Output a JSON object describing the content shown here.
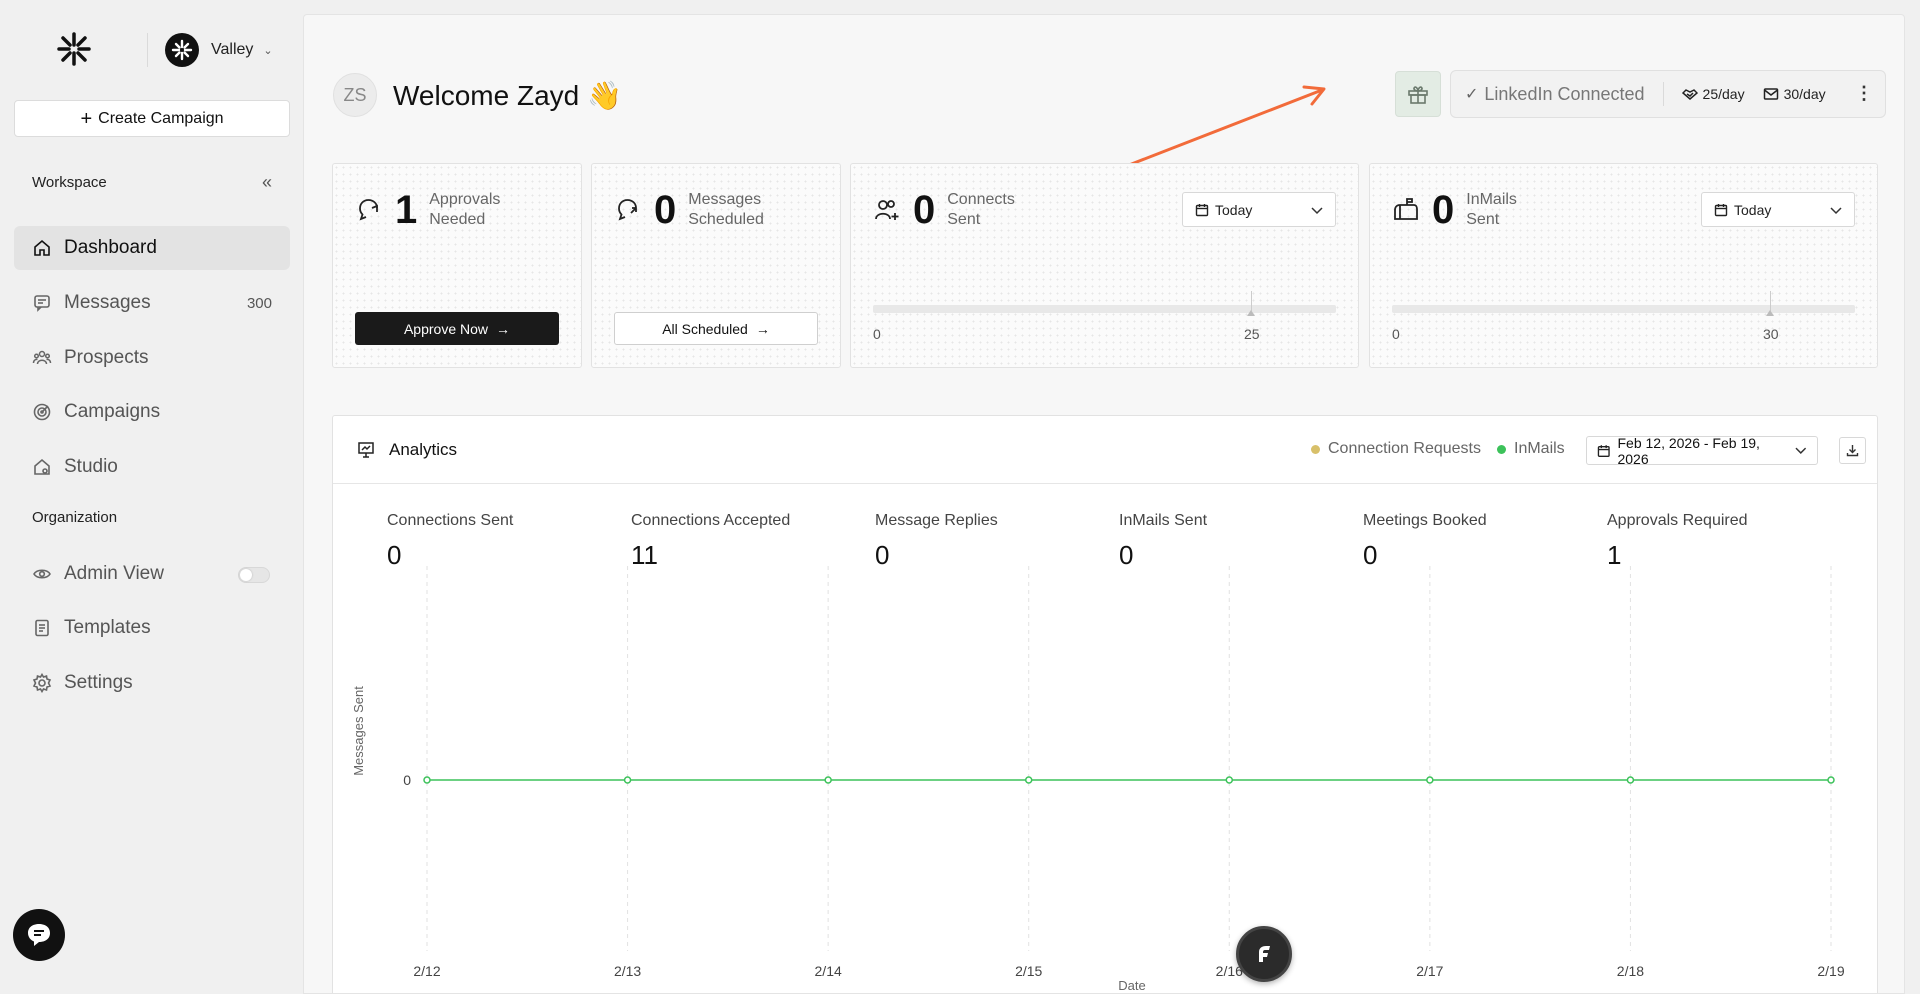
{
  "workspace": {
    "name": "Valley"
  },
  "sidebar": {
    "create_label": "Create Campaign",
    "workspace_label": "Workspace",
    "organization_label": "Organization",
    "items": [
      {
        "label": "Dashboard",
        "icon": "home-icon",
        "active": true
      },
      {
        "label": "Messages",
        "icon": "message-icon",
        "count": "300"
      },
      {
        "label": "Prospects",
        "icon": "users-icon"
      },
      {
        "label": "Campaigns",
        "icon": "target-icon"
      },
      {
        "label": "Studio",
        "icon": "studio-icon"
      }
    ],
    "org_items": [
      {
        "label": "Admin View",
        "icon": "eye-icon",
        "toggle": false
      },
      {
        "label": "Templates",
        "icon": "document-icon"
      },
      {
        "label": "Settings",
        "icon": "gear-icon"
      }
    ]
  },
  "header": {
    "initials": "ZS",
    "welcome": "Welcome Zayd 👋",
    "linkedin_status": "LinkedIn Connected",
    "connect_limit": "25/day",
    "inmail_limit": "30/day"
  },
  "cards": {
    "approvals": {
      "value": "1",
      "label_1": "Approvals",
      "label_2": "Needed",
      "button": "Approve Now"
    },
    "scheduled": {
      "value": "0",
      "label_1": "Messages",
      "label_2": "Scheduled",
      "button": "All Scheduled"
    },
    "connects": {
      "value": "0",
      "label_1": "Connects",
      "label_2": "Sent",
      "range": "Today",
      "min": "0",
      "max": "25",
      "progress": 0
    },
    "inmails": {
      "value": "0",
      "label_1": "InMails",
      "label_2": "Sent",
      "range": "Today",
      "min": "0",
      "max": "30",
      "progress": 0
    }
  },
  "analytics": {
    "title": "Analytics",
    "legend": [
      {
        "label": "Connection Requests",
        "color": "#d8c06a"
      },
      {
        "label": "InMails",
        "color": "#3cc25a"
      }
    ],
    "date_range": "Feb 12, 2026 - Feb 19, 2026",
    "metrics": [
      {
        "label": "Connections Sent",
        "value": "0"
      },
      {
        "label": "Connections Accepted",
        "value": "11"
      },
      {
        "label": "Message Replies",
        "value": "0"
      },
      {
        "label": "InMails Sent",
        "value": "0"
      },
      {
        "label": "Meetings Booked",
        "value": "0"
      },
      {
        "label": "Approvals Required",
        "value": "1"
      }
    ]
  },
  "chart_data": {
    "type": "line",
    "x": [
      "2/12",
      "2/13",
      "2/14",
      "2/15",
      "2/16",
      "2/17",
      "2/18",
      "2/19"
    ],
    "series": [
      {
        "name": "InMails",
        "values": [
          0,
          0,
          0,
          0,
          0,
          0,
          0,
          0
        ],
        "color": "#3cc25a"
      }
    ],
    "xlabel": "Date",
    "ylabel": "Messages Sent",
    "yticks": [
      "0"
    ]
  }
}
